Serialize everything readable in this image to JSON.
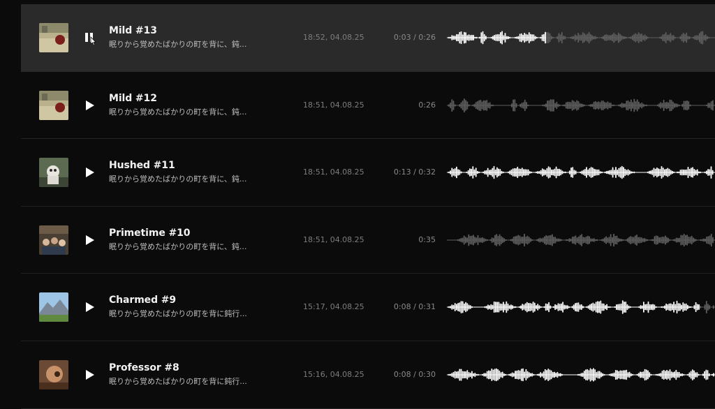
{
  "colors": {
    "background": "#0b0b0b",
    "active_row": "#2a2a2a",
    "waveform_played": "#ffffff",
    "waveform_unplayed": "#5e5e5e",
    "title_text": "#f2f2f2",
    "secondary_text": "#8a8a8a"
  },
  "tracks": [
    {
      "title": "Mild #13",
      "description": "眠りから覚めたばかりの町を背に、鈍...",
      "timestamp": "18:52, 04.08.25",
      "duration": "0:03 / 0:26",
      "state": "playing",
      "control_icon": "pause-icon",
      "progress": 0.37,
      "thumbnail": "kitchen-scene",
      "waveform_seed": 13
    },
    {
      "title": "Mild #12",
      "description": "眠りから覚めたばかりの町を背に、鈍...",
      "timestamp": "18:51, 04.08.25",
      "duration": "0:26",
      "state": "idle",
      "control_icon": "play-icon",
      "progress": 0,
      "thumbnail": "kitchen-scene",
      "waveform_seed": 12
    },
    {
      "title": "Hushed #11",
      "description": "眠りから覚めたばかりの町を背に、鈍...",
      "timestamp": "18:51, 04.08.25",
      "duration": "0:13 / 0:32",
      "state": "paused",
      "control_icon": "play-icon",
      "progress": 1.0,
      "thumbnail": "cat-scene",
      "waveform_seed": 11
    },
    {
      "title": "Primetime #10",
      "description": "眠りから覚めたばかりの町を背に、鈍...",
      "timestamp": "18:51, 04.08.25",
      "duration": "0:35",
      "state": "idle",
      "control_icon": "play-icon",
      "progress": 0,
      "thumbnail": "group-scene",
      "waveform_seed": 10
    },
    {
      "title": "Charmed #9",
      "description": "眠りから覚めたばかりの町を背に鈍行...",
      "timestamp": "15:17, 04.08.25",
      "duration": "0:08 / 0:31",
      "state": "paused",
      "control_icon": "play-icon",
      "progress": 0.94,
      "thumbnail": "mountain-scene",
      "waveform_seed": 9
    },
    {
      "title": "Professor #8",
      "description": "眠りから覚めたばかりの町を背に鈍行...",
      "timestamp": "15:16, 04.08.25",
      "duration": "0:08 / 0:30",
      "state": "paused",
      "control_icon": "play-icon",
      "progress": 1.0,
      "thumbnail": "portrait-scene",
      "waveform_seed": 8
    }
  ]
}
